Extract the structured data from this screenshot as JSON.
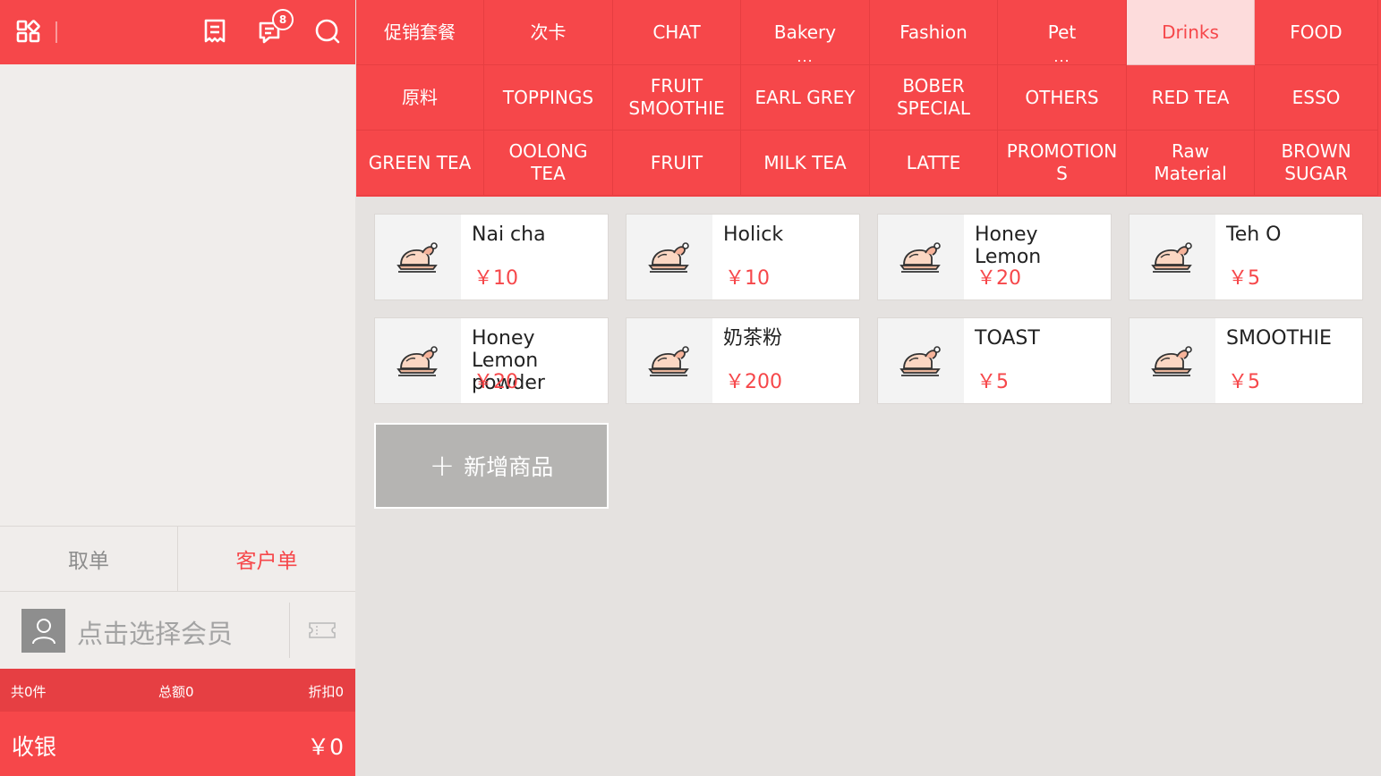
{
  "topbar": {
    "badge_count": "8",
    "accent": "#f6474a"
  },
  "order": {
    "cancel_label": "取单",
    "customer_label": "客户单",
    "member_placeholder": "点击选择会员"
  },
  "summary": {
    "count": "共0件",
    "total": "总额0",
    "discount": "折扣0"
  },
  "checkout": {
    "label": "收银",
    "amount": "￥0"
  },
  "categories": [
    {
      "label": "促销套餐"
    },
    {
      "label": "次卡"
    },
    {
      "label": "CHAT"
    },
    {
      "label": "Bakery",
      "dots": "..."
    },
    {
      "label": "Fashion"
    },
    {
      "label": "Pet",
      "dots": "..."
    },
    {
      "label": "Drinks",
      "active": true
    },
    {
      "label": "FOOD"
    },
    {
      "label": "原料"
    },
    {
      "label": "TOPPINGS"
    },
    {
      "label": "FRUIT SMOOTHIE"
    },
    {
      "label": "EARL GREY"
    },
    {
      "label": "BOBER SPECIAL"
    },
    {
      "label": "OTHERS"
    },
    {
      "label": "RED TEA"
    },
    {
      "label": "ESSO"
    },
    {
      "label": "GREEN TEA"
    },
    {
      "label": "OOLONG TEA"
    },
    {
      "label": "FRUIT"
    },
    {
      "label": "MILK TEA"
    },
    {
      "label": "LATTE"
    },
    {
      "label": "PROMOTION S"
    },
    {
      "label": "Raw Material"
    },
    {
      "label": "BROWN SUGAR"
    }
  ],
  "products": [
    {
      "name": "Nai cha",
      "price": "￥10"
    },
    {
      "name": "Holick",
      "price": "￥10"
    },
    {
      "name": "Honey Lemon",
      "price": "￥20"
    },
    {
      "name": "Teh O",
      "price": "￥5"
    },
    {
      "name": "Honey Lemon powder",
      "price": "￥20"
    },
    {
      "name": "奶茶粉",
      "price": "￥200"
    },
    {
      "name": "TOAST",
      "price": "￥5"
    },
    {
      "name": "SMOOTHIE",
      "price": "￥5"
    }
  ],
  "add_product": {
    "plus": "+",
    "label": "新增商品"
  }
}
